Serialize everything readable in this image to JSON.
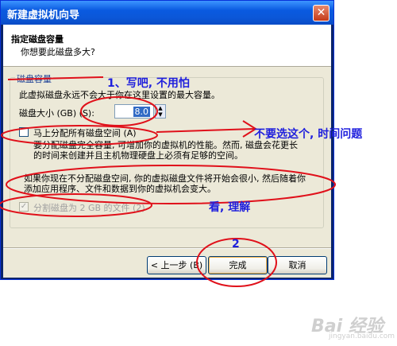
{
  "window": {
    "title": "新建虚拟机向导",
    "close_glyph": "✕"
  },
  "header": {
    "title": "指定磁盘容量",
    "subtitle": "你想要此磁盘多大?"
  },
  "group": {
    "legend": "磁盘容量",
    "description": "此虚拟磁盘永远不会大于你在这里设置的最大容量。",
    "size_label": "磁盘大小 (GB) (S):",
    "size_value": "8.0",
    "allocate_label": "马上分配所有磁盘空间 (A)",
    "allocate_checked": false,
    "allocate_note": "要分配磁盘完全容量, 可增加你的虚拟机的性能。然而, 磁盘会花更长的时间来创建并且主机物理硬盘上必须有足够的空间。",
    "no_allocate_note": "如果你现在不分配磁盘空间, 你的虚拟磁盘文件将开始会很小, 然后随着你添加应用程序、文件和数据到你的虚拟机会变大。",
    "split_label": "分割磁盘为 2 GB 的文件 (2)",
    "split_checked": true
  },
  "buttons": {
    "back": "< 上一步 (B)",
    "finish": "完成",
    "cancel": "取消"
  },
  "annotations": {
    "a1": "1、写吧, 不用怕",
    "a2": "不要选这个, 时间问题",
    "a3": "看, 理解",
    "a4": "2",
    "color": "#1f1fdd",
    "ellipse_color": "#e0101a"
  },
  "watermark": {
    "text": "Bai 经验",
    "sub": "jingyan.baidu.com"
  }
}
